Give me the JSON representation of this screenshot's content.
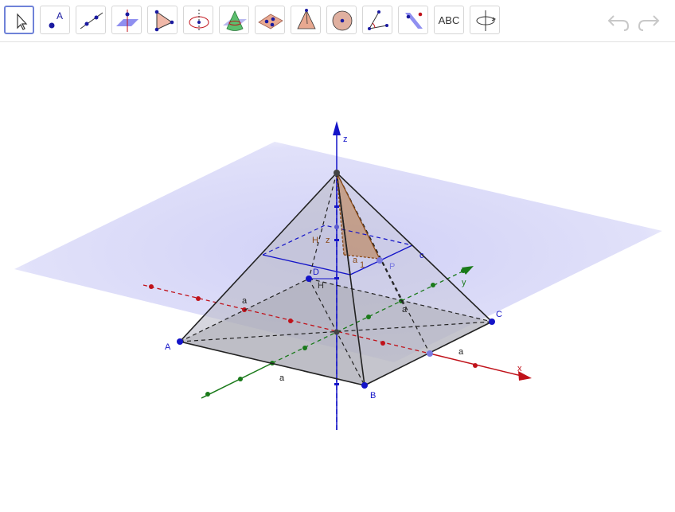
{
  "toolbar": {
    "tools": [
      {
        "name": "move-tool",
        "icon": "arrow-cursor-icon",
        "selected": true
      },
      {
        "name": "point-tool",
        "icon": "point-icon",
        "label": "A"
      },
      {
        "name": "line-tool",
        "icon": "line-icon"
      },
      {
        "name": "perpendicular-line-tool",
        "icon": "perpendicular-line-icon"
      },
      {
        "name": "polygon-tool",
        "icon": "polygon-icon"
      },
      {
        "name": "circle-axis-tool",
        "icon": "circle-axis-icon"
      },
      {
        "name": "intersect-surfaces-tool",
        "icon": "intersect-surfaces-icon"
      },
      {
        "name": "plane-tool",
        "icon": "plane-icon"
      },
      {
        "name": "pyramid-tool",
        "icon": "pyramid-icon"
      },
      {
        "name": "sphere-tool",
        "icon": "sphere-icon"
      },
      {
        "name": "angle-tool",
        "icon": "angle-icon"
      },
      {
        "name": "reflect-tool",
        "icon": "reflect-plane-icon"
      },
      {
        "name": "text-tool",
        "icon": "text-icon",
        "label": "ABC"
      },
      {
        "name": "rotate-view-tool",
        "icon": "rotate-view-icon"
      }
    ],
    "undo_icon": "undo-icon",
    "redo_icon": "redo-icon"
  },
  "scene": {
    "colors": {
      "plane": "#c8c8f5",
      "x_axis": "#c0121a",
      "y_axis": "#1a7a1a",
      "z_axis": "#1414c8",
      "points": "#1414c8",
      "triangle": "#b5651d"
    },
    "labels": {
      "z_axis": "z",
      "x_axis": "x",
      "y_axis": "y",
      "A": "A",
      "B": "B",
      "C": "C",
      "D": "D",
      "H": "H",
      "P": "P",
      "H_upper": "H",
      "z_side": "z",
      "a_front": "a",
      "a_right": "a",
      "a_left": "a",
      "a_mid": "a",
      "a_small": "a",
      "one": "1",
      "c": "c"
    }
  }
}
